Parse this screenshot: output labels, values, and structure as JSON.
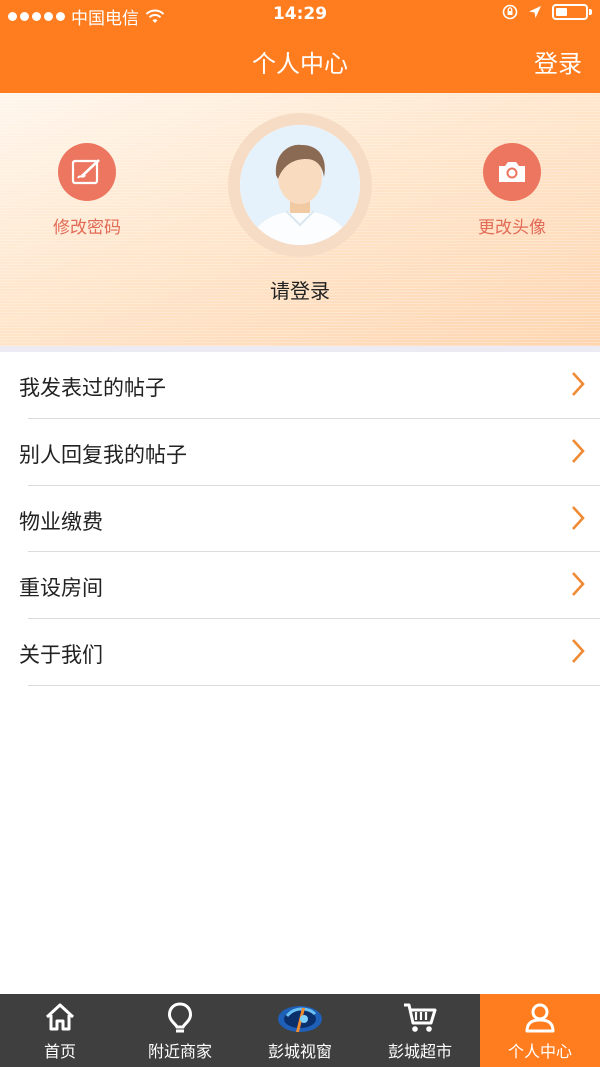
{
  "status_bar": {
    "carrier": "中国电信",
    "time": "14:29",
    "battery_level": 0.35
  },
  "nav": {
    "title": "个人中心",
    "login_button": "登录"
  },
  "profile": {
    "change_password_label": "修改密码",
    "change_avatar_label": "更改头像",
    "login_prompt": "请登录"
  },
  "menu": {
    "items": [
      {
        "label": "我发表过的帖子"
      },
      {
        "label": "别人回复我的帖子"
      },
      {
        "label": "物业缴费"
      },
      {
        "label": "重设房间"
      },
      {
        "label": "关于我们"
      }
    ]
  },
  "tabbar": {
    "tabs": [
      {
        "label": "首页",
        "icon": "home-icon"
      },
      {
        "label": "附近商家",
        "icon": "location-pin-icon"
      },
      {
        "label": "彭城视窗",
        "icon": "window-logo-icon"
      },
      {
        "label": "彭城超市",
        "icon": "shopping-cart-icon"
      },
      {
        "label": "个人中心",
        "icon": "user-icon"
      }
    ],
    "active_index": 4
  },
  "colors": {
    "brand_orange": "#ff7d1f",
    "action_red": "#ec7660",
    "tabbar_bg": "#3f3f3f"
  }
}
